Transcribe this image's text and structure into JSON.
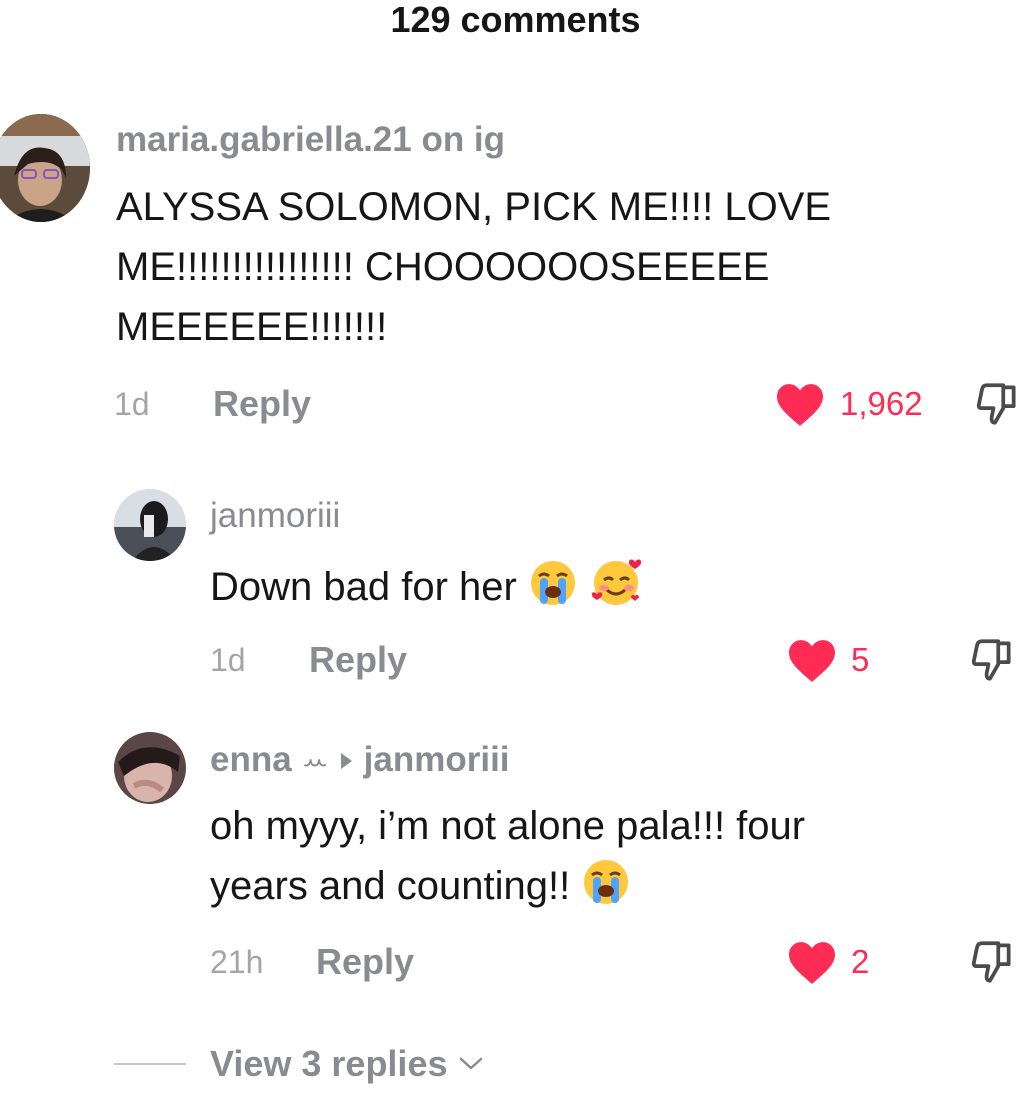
{
  "header": {
    "title": "129 comments"
  },
  "comments": [
    {
      "username": "maria.gabriella.21 on ig",
      "lines": [
        "ALYSSA SOLOMON, PICK ME!!!! LOVE",
        "ME!!!!!!!!!!!!!!!! CHOOOOOOSEEEEE",
        "MEEEEEE!!!!!!!"
      ],
      "time": "1d",
      "reply_label": "Reply",
      "likes": "1,962"
    },
    {
      "username": "janmoriii",
      "text": "Down bad for her",
      "emojis": [
        "loudly-crying-face",
        "smiling-face-with-hearts"
      ],
      "time": "1d",
      "reply_label": "Reply",
      "likes": "5"
    },
    {
      "username": "enna",
      "username_glyph": "ꕀ",
      "reply_to": "janmoriii",
      "lines": [
        "oh myyy, i’m not alone pala!!! four",
        "years and counting!!"
      ],
      "emojis": [
        "loudly-crying-face"
      ],
      "time": "21h",
      "reply_label": "Reply",
      "likes": "2"
    }
  ],
  "view_more": {
    "label": "View 3 replies"
  },
  "colors": {
    "like": "#fe2c55",
    "secondary_text": "#8a8b91",
    "primary_text": "#161616"
  }
}
